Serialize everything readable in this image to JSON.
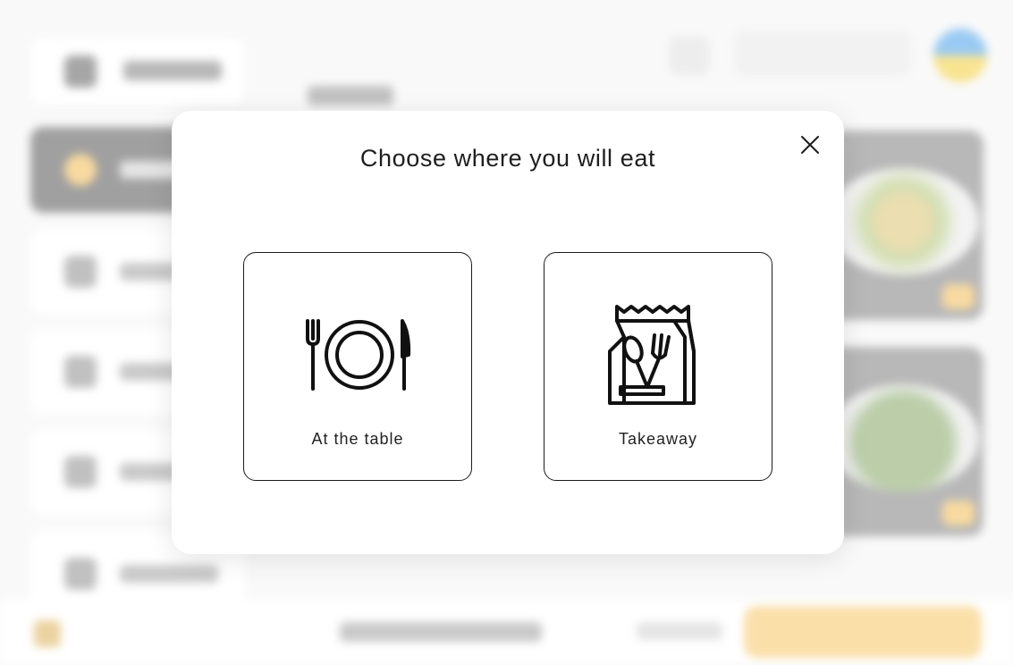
{
  "modal": {
    "title": "Choose where you will eat",
    "close_icon": "close-icon",
    "options": [
      {
        "label": "At the table",
        "icon": "plate-cutlery-icon"
      },
      {
        "label": "Takeaway",
        "icon": "takeaway-bag-icon"
      }
    ]
  },
  "colors": {
    "modal_background": "#ffffff",
    "text": "#1e1e1e",
    "option_border": "#1c1c1c",
    "accent": "#f6c25b"
  }
}
